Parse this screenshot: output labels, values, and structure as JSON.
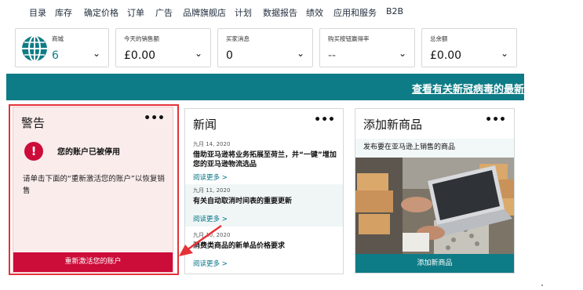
{
  "nav": {
    "items": [
      "目录",
      "库存",
      "确定价格",
      "订单",
      "广告",
      "品牌旗舰店",
      "计划",
      "数据报告",
      "绩效",
      "应用和服务",
      "B2B"
    ]
  },
  "stats": [
    {
      "label": "商城",
      "value": "6",
      "icon": "globe-icon"
    },
    {
      "label": "今天的销售额",
      "value": "£0.00"
    },
    {
      "label": "买家消息",
      "value": "0"
    },
    {
      "label": "购买按钮赢得率",
      "value": "--"
    },
    {
      "label": "总余额",
      "value": "£0.00"
    }
  ],
  "banner": {
    "text": "查看有关新冠病毒的最新"
  },
  "alert": {
    "title": "警告",
    "menu": "•••",
    "heading": "您的账户已被停用",
    "body": "请单击下面的“重新激活您的账户”以恢复销售",
    "button": "重新激活您的账户",
    "accent": "#cc0c39",
    "outline": "#e53238"
  },
  "news": {
    "title": "新闻",
    "menu": "•••",
    "items": [
      {
        "date": "九月 14, 2020",
        "headline": "借助亚马逊将业务拓展至荷兰，并“一键”增加您的亚马逊物流选品",
        "more": "阅读更多 >"
      },
      {
        "date": "九月 11, 2020",
        "headline": "有关自动取消时间表的重要更新",
        "more": "阅读更多 >"
      },
      {
        "date": "九月 10, 2020",
        "headline": "消费类商品的新单品价格要求",
        "more": "阅读更多 >"
      }
    ]
  },
  "add_product": {
    "title": "添加新商品",
    "menu": "•••",
    "subtitle": "发布要在亚马逊上销售的商品",
    "button": "添加新商品"
  },
  "colors": {
    "teal": "#0e7c86",
    "navy": "#232f3e",
    "link": "#007185"
  }
}
